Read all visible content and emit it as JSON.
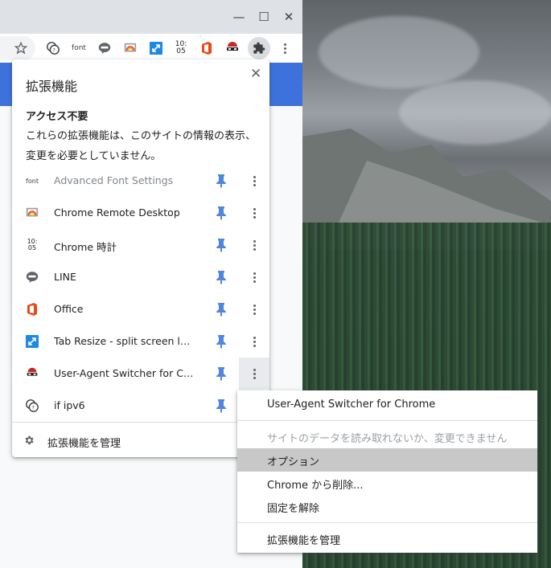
{
  "window": {
    "minimize_glyph": "—",
    "maximize_glyph": "☐",
    "close_glyph": "✕"
  },
  "toolbar": {
    "icons": [
      "star-icon",
      "if-ipv6-icon",
      "font-icon",
      "line-icon",
      "chrome-remote-desktop-icon",
      "tab-resize-icon",
      "chrome-clock-icon",
      "office-icon",
      "user-agent-switcher-icon",
      "extensions-puzzle-icon",
      "menu-kebab-icon"
    ],
    "font_label": "font",
    "clock_top": "10:",
    "clock_bottom": "05"
  },
  "popup": {
    "title": "拡張機能",
    "close_glyph": "✕",
    "section_heading": "アクセス不要",
    "section_desc": "これらの拡張機能は、このサイトの情報の表示、変更を必要としていません。",
    "extensions": [
      {
        "name": "Advanced Font Settings",
        "icon": "font-icon",
        "icon_text": "font"
      },
      {
        "name": "Chrome Remote Desktop",
        "icon": "chrome-remote-desktop-icon"
      },
      {
        "name": "Chrome 時計",
        "icon": "chrome-clock-icon",
        "icon_text_top": "10:",
        "icon_text_bottom": "05"
      },
      {
        "name": "LINE",
        "icon": "line-icon"
      },
      {
        "name": "Office",
        "icon": "office-icon"
      },
      {
        "name": "Tab Resize - split screen layouts",
        "icon": "tab-resize-icon"
      },
      {
        "name": "User-Agent Switcher for Chrome",
        "icon": "user-agent-switcher-icon"
      },
      {
        "name": "if ipv6",
        "icon": "if-ipv6-icon"
      }
    ],
    "manage_label": "拡張機能を管理"
  },
  "context_menu": {
    "title": "User-Agent Switcher for Chrome",
    "disabled_item": "サイトのデータを読み取れないか、変更できません",
    "options": "オプション",
    "remove": "Chrome から削除...",
    "unpin": "固定を解除",
    "manage": "拡張機能を管理"
  },
  "colors": {
    "accent_blue": "#3d72dc",
    "pin_blue": "#4f87e0",
    "highlight": "#c8c8c8"
  }
}
